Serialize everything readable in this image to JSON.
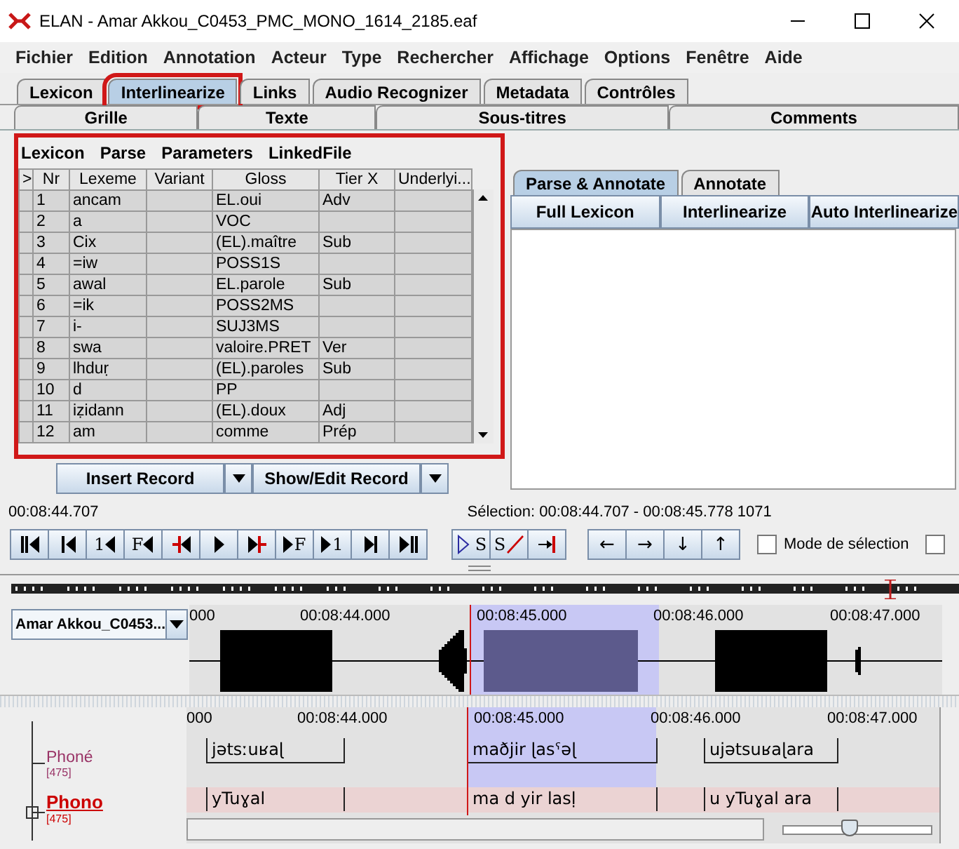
{
  "window": {
    "title": "ELAN - Amar Akkou_C0453_PMC_MONO_1614_2185.eaf"
  },
  "menu": [
    "Fichier",
    "Edition",
    "Annotation",
    "Acteur",
    "Type",
    "Rechercher",
    "Affichage",
    "Options",
    "Fenêtre",
    "Aide"
  ],
  "tabs": [
    {
      "label": "Lexicon",
      "selected": false
    },
    {
      "label": "Interlinearize",
      "selected": true
    },
    {
      "label": "Links",
      "selected": false
    },
    {
      "label": "Audio Recognizer",
      "selected": false
    },
    {
      "label": "Metadata",
      "selected": false
    },
    {
      "label": "Contrôles",
      "selected": false
    }
  ],
  "view_tabs": [
    {
      "label": "Grille",
      "selected": false
    },
    {
      "label": "Texte",
      "selected": false
    },
    {
      "label": "Sous-titres",
      "selected": false
    },
    {
      "label": "Comments",
      "selected": false
    }
  ],
  "lexicon_panel": {
    "menu": [
      "Lexicon",
      "Parse",
      "Parameters",
      "LinkedFile"
    ],
    "columns": [
      ">",
      "Nr",
      "Lexeme",
      "Variant",
      "Gloss",
      "Tier X",
      "Underlyi..."
    ],
    "rows": [
      {
        "cells": [
          "",
          "1",
          "ancam",
          "",
          "EL.oui",
          "Adv",
          ""
        ]
      },
      {
        "cells": [
          "",
          "2",
          "a",
          "",
          "VOC",
          "",
          ""
        ]
      },
      {
        "cells": [
          "",
          "3",
          "Cix",
          "",
          "(EL).maître",
          "Sub",
          ""
        ]
      },
      {
        "cells": [
          "",
          "4",
          "=iw",
          "",
          "POSS1S",
          "",
          ""
        ]
      },
      {
        "cells": [
          "",
          "5",
          "awal",
          "",
          "EL.parole",
          "Sub",
          ""
        ]
      },
      {
        "cells": [
          "",
          "6",
          "=ik",
          "",
          "POSS2MS",
          "",
          ""
        ]
      },
      {
        "cells": [
          "",
          "7",
          "i-",
          "",
          "SUJ3MS",
          "",
          ""
        ]
      },
      {
        "cells": [
          "",
          "8",
          "swa",
          "",
          "valoire.PRET",
          "Ver",
          ""
        ]
      },
      {
        "cells": [
          "",
          "9",
          "lhduṛ",
          "",
          "(EL).paroles",
          "Sub",
          ""
        ]
      },
      {
        "cells": [
          "",
          "10",
          "d",
          "",
          "PP",
          "",
          ""
        ]
      },
      {
        "cells": [
          "",
          "11",
          "iẓidann",
          "",
          "(EL).doux",
          "Adj",
          ""
        ]
      },
      {
        "cells": [
          "",
          "12",
          "am",
          "",
          "comme",
          "Prép",
          ""
        ]
      }
    ],
    "buttons": [
      "Insert Record",
      "Show/Edit Record"
    ]
  },
  "annotate_panel": {
    "tabs": [
      {
        "label": "Parse & Annotate",
        "selected": true
      },
      {
        "label": "Annotate",
        "selected": false
      }
    ],
    "buttons": [
      "Full Lexicon",
      "Interlinearize",
      "Auto Interlinearize"
    ]
  },
  "media": {
    "time": "00:08:44.707",
    "selection": "Sélection: 00:08:44.707 - 00:08:45.778  1071",
    "player_buttons": [
      {
        "kind": "to-start"
      },
      {
        "kind": "step-back"
      },
      {
        "kind": "back",
        "label": "1"
      },
      {
        "kind": "back",
        "label": "F"
      },
      {
        "kind": "sel-start"
      },
      {
        "kind": "play"
      },
      {
        "kind": "play-sel"
      },
      {
        "kind": "fwd",
        "label": "F"
      },
      {
        "kind": "fwd",
        "label": "1"
      },
      {
        "kind": "step-fwd"
      },
      {
        "kind": "to-end"
      }
    ],
    "selection_buttons": [
      {
        "kind": "play-outline",
        "label": "S"
      },
      {
        "kind": "clear",
        "label": "S"
      },
      {
        "kind": "to-sel-end"
      }
    ],
    "arrow_buttons": [
      "←",
      "→",
      "↓",
      "↑"
    ],
    "checkboxes": [
      {
        "label": "Mode de sélection",
        "checked": false
      },
      {
        "checked": false
      }
    ]
  },
  "waveform": {
    "media_name": "Amar Akkou_C0453...",
    "ruler": [
      "000",
      "00:08:44.000",
      "00:08:45.000",
      "00:08:46.000",
      "00:08:47.000"
    ]
  },
  "tiers": {
    "zoom_slider": {
      "level": 0.45
    },
    "ruler": [
      "000",
      "00:08:44.000",
      "00:08:45.000",
      "00:08:46.000",
      "00:08:47.000"
    ],
    "items": [
      {
        "name": "Phoné",
        "count": "[475]",
        "color": "#993366",
        "selected": false,
        "annotations": [
          "jətsːuʁaɭ",
          "maðjir ɭasˤəɭ",
          "ujətsuʁaɭara"
        ]
      },
      {
        "name": "Phono",
        "count": "[475]",
        "color": "#cc0000",
        "selected": true,
        "annotations": [
          "yTuɣal",
          "ma d yir lasḷ",
          "u yTuɣal ara"
        ]
      }
    ]
  }
}
